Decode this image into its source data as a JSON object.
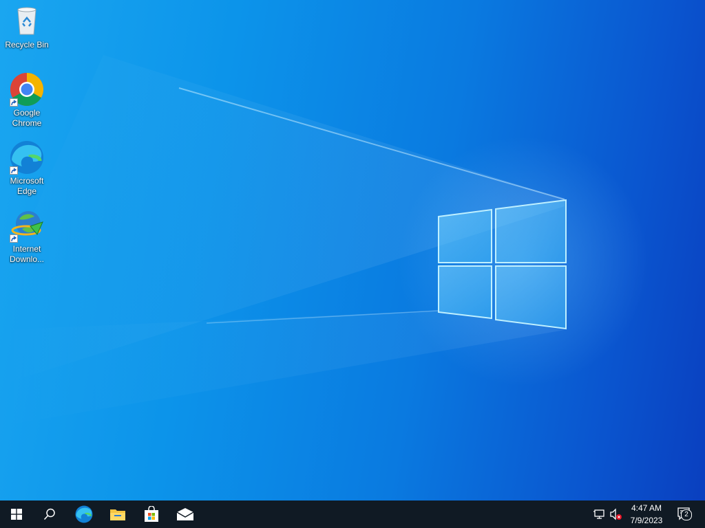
{
  "desktop": {
    "icons": [
      {
        "label": "Recycle Bin",
        "icon": "recycle-bin-icon"
      },
      {
        "label": "Google Chrome",
        "icon": "chrome-icon"
      },
      {
        "label": "Microsoft Edge",
        "icon": "edge-icon"
      },
      {
        "label": "Internet Downlo...",
        "icon": "idm-icon"
      }
    ]
  },
  "taskbar": {
    "buttons": [
      {
        "name": "start",
        "icon": "windows-logo-icon"
      },
      {
        "name": "search",
        "icon": "search-icon"
      },
      {
        "name": "edge",
        "icon": "edge-icon"
      },
      {
        "name": "file-explorer",
        "icon": "folder-icon"
      },
      {
        "name": "microsoft-store",
        "icon": "store-icon"
      },
      {
        "name": "mail",
        "icon": "mail-icon"
      }
    ],
    "tray": {
      "network_icon": "network-icon",
      "volume_icon": "volume-muted-icon",
      "time": "4:47 AM",
      "date": "7/9/2023",
      "notification_count": "2"
    }
  },
  "colors": {
    "taskbar": "#101a24",
    "wallpaper_primary": "#0c94ea",
    "wallpaper_dark": "#0a3fbf"
  }
}
